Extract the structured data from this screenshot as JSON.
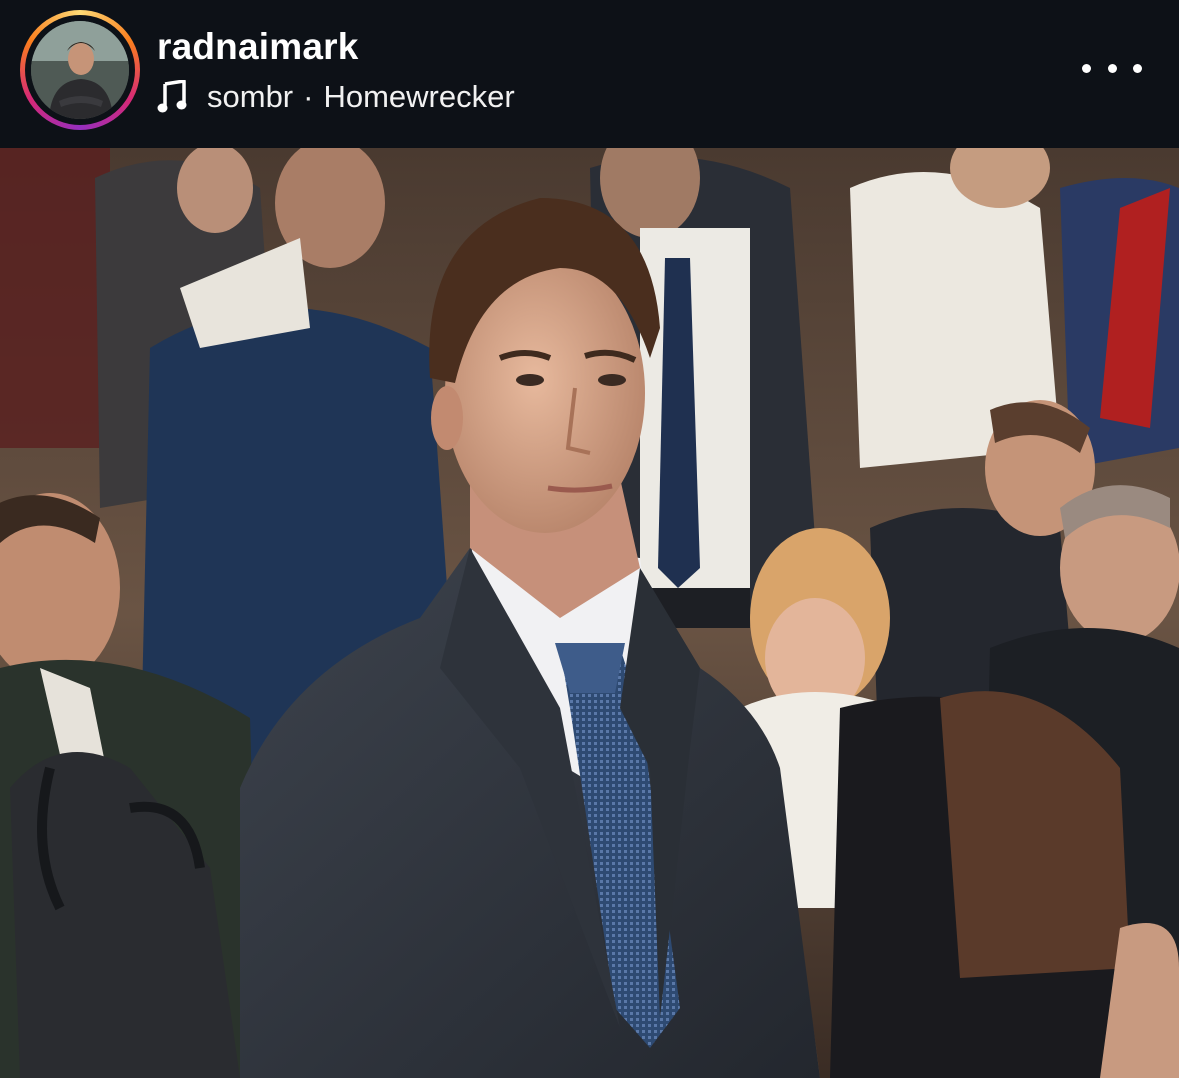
{
  "post": {
    "username": "radnaimark",
    "music": {
      "artist": "sombr",
      "separator": "·",
      "track": "Homewrecker"
    },
    "menu_icon": "more-horizontal-icon",
    "music_icon": "music-note-icon",
    "story_ring_colors": [
      "#feda75",
      "#fa7e1e",
      "#d62976",
      "#962fbf"
    ]
  }
}
